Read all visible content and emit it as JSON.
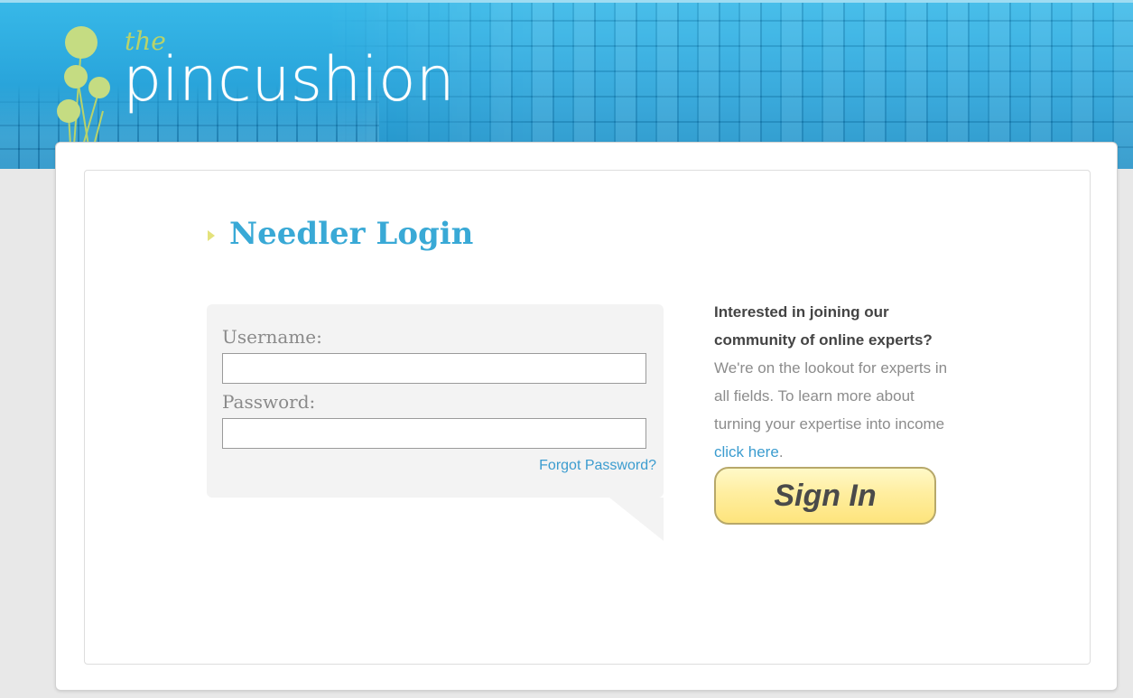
{
  "brand": {
    "prefix": "the",
    "name": "pincushion"
  },
  "page": {
    "title": "Needler Login"
  },
  "login_form": {
    "username_label": "Username:",
    "username_value": "",
    "password_label": "Password:",
    "password_value": "",
    "forgot_link": "Forgot Password?"
  },
  "promo": {
    "heading": "Interested in joining our community of online experts?",
    "body": "We're on the lookout for experts in all fields. To learn more about turning your expertise into income",
    "link_text": "click here",
    "trailing": "."
  },
  "actions": {
    "signin_label": "Sign In"
  },
  "colors": {
    "accent_blue": "#39a9d6",
    "logo_green": "#b8d36a",
    "button_yellow": "#ffeea0"
  }
}
